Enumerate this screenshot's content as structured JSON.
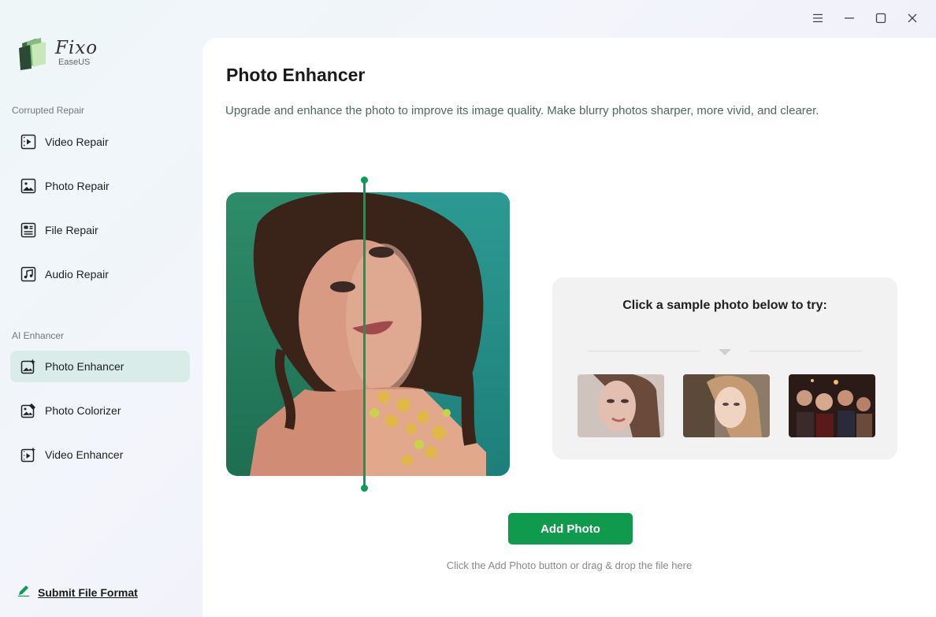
{
  "app": {
    "name": "Fixo",
    "vendor": "EaseUS"
  },
  "window_controls": {
    "icons": [
      "menu-icon",
      "minimize-icon",
      "maximize-icon",
      "close-icon"
    ]
  },
  "sidebar": {
    "sections": [
      {
        "title": "Corrupted Repair",
        "items": [
          {
            "label": "Video Repair",
            "icon": "video-icon"
          },
          {
            "label": "Photo Repair",
            "icon": "photo-icon"
          },
          {
            "label": "File Repair",
            "icon": "file-icon"
          },
          {
            "label": "Audio Repair",
            "icon": "music-icon"
          }
        ]
      },
      {
        "title": "AI Enhancer",
        "items": [
          {
            "label": "Photo Enhancer",
            "icon": "photo-sparkle-icon",
            "active": true
          },
          {
            "label": "Photo Colorizer",
            "icon": "photo-color-icon"
          },
          {
            "label": "Video Enhancer",
            "icon": "video-sparkle-icon"
          }
        ]
      }
    ],
    "submit_link": "Submit File Format"
  },
  "main": {
    "title": "Photo Enhancer",
    "description": "Upgrade and enhance the photo to improve its image quality. Make blurry photos sharper, more vivid, and clearer.",
    "sample": {
      "title": "Click a sample photo below to try:",
      "thumbnails": [
        "sample-portrait-1",
        "sample-portrait-2",
        "sample-group-photo"
      ]
    },
    "add_button": "Add Photo",
    "hint": "Click the Add Photo button or drag & drop the file here"
  },
  "colors": {
    "accent": "#109a4e",
    "active_nav_bg": "#d9ece8",
    "sample_box_bg": "#f2f2f2",
    "description_text": "#4c6a5f"
  }
}
